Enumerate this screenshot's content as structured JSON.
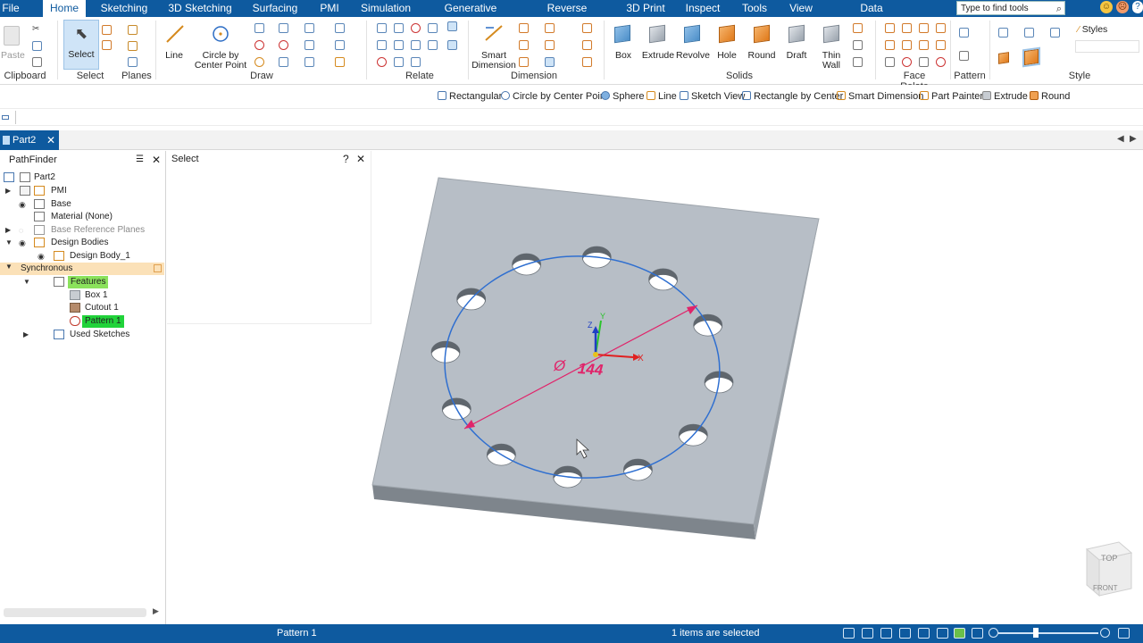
{
  "menu": {
    "items": [
      {
        "label": "File"
      },
      {
        "label": "Home",
        "active": true
      },
      {
        "label": "Sketching"
      },
      {
        "label": "3D Sketching"
      },
      {
        "label": "Surfacing"
      },
      {
        "label": "PMI"
      },
      {
        "label": "Simulation"
      },
      {
        "label": "Generative Design"
      },
      {
        "label": "Reverse Engineering"
      },
      {
        "label": "3D Print"
      },
      {
        "label": "Inspect"
      },
      {
        "label": "Tools"
      },
      {
        "label": "View"
      },
      {
        "label": "Data Management"
      }
    ],
    "search_placeholder": "Type to find tools"
  },
  "ribbon": {
    "paste_label": "Paste",
    "select_label": "Select",
    "line_label": "Line",
    "circle_label_1": "Circle by",
    "circle_label_2": "Center Point",
    "smart_dim_1": "Smart",
    "smart_dim_2": "Dimension",
    "box_label": "Box",
    "extrude_label": "Extrude",
    "revolve_label": "Revolve",
    "hole_label": "Hole",
    "round_label": "Round",
    "draft_label": "Draft",
    "thin_wall_1": "Thin",
    "thin_wall_2": "Wall",
    "styles_label": "Styles",
    "groups": {
      "clipboard": "Clipboard",
      "select": "Select",
      "planes": "Planes",
      "draw": "Draw",
      "relate": "Relate",
      "dimension": "Dimension",
      "solids": "Solids",
      "face_relate": "Face Relate",
      "pattern": "Pattern",
      "style": "Style"
    }
  },
  "quickbar": {
    "items": [
      "Rectangular",
      "Circle by Center Point",
      "Sphere",
      "Line",
      "Sketch View",
      "Rectangle by Center",
      "Smart Dimension",
      "Part Painter",
      "Extrude",
      "Round"
    ]
  },
  "document": {
    "tab_label": "Part2"
  },
  "pathfinder": {
    "title": "PathFinder",
    "tree": {
      "part": "Part2",
      "pmi": "PMI",
      "base": "Base",
      "material": "Material (None)",
      "base_planes": "Base Reference Planes",
      "design_bodies": "Design Bodies",
      "design_body_1": "Design Body_1",
      "synchronous": "Synchronous",
      "features": "Features",
      "box_1": "Box 1",
      "cutout_1": "Cutout 1",
      "pattern_1": "Pattern 1",
      "used_sketches": "Used Sketches"
    }
  },
  "select_panel": {
    "title": "Select"
  },
  "viewport": {
    "dimension_symbol": "Ø",
    "dimension_value": "144",
    "axis_x": "X",
    "axis_y": "Y",
    "axis_z": "Z",
    "viewcube_top": "TOP",
    "viewcube_front": "FRONT",
    "hole_count": 12,
    "colors": {
      "plate": "#b7bec6",
      "circle": "#2f6fd0",
      "dimension": "#e0246a"
    }
  },
  "status": {
    "left": "Pattern 1",
    "middle": "1 items are selected"
  }
}
